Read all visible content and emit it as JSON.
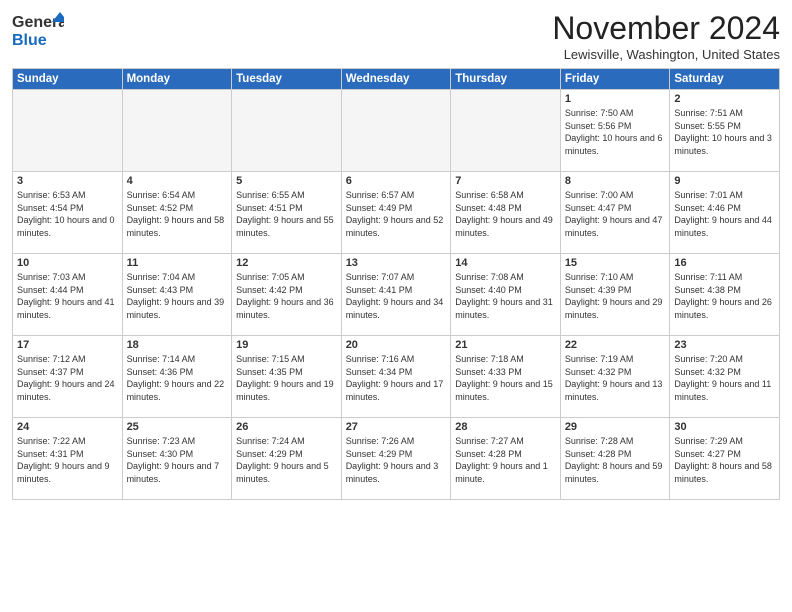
{
  "header": {
    "logo_general": "General",
    "logo_blue": "Blue",
    "month_title": "November 2024",
    "location": "Lewisville, Washington, United States"
  },
  "calendar": {
    "days_of_week": [
      "Sunday",
      "Monday",
      "Tuesday",
      "Wednesday",
      "Thursday",
      "Friday",
      "Saturday"
    ],
    "weeks": [
      [
        {
          "day": "",
          "detail": ""
        },
        {
          "day": "",
          "detail": ""
        },
        {
          "day": "",
          "detail": ""
        },
        {
          "day": "",
          "detail": ""
        },
        {
          "day": "",
          "detail": ""
        },
        {
          "day": "1",
          "detail": "Sunrise: 7:50 AM\nSunset: 5:56 PM\nDaylight: 10 hours and 6 minutes."
        },
        {
          "day": "2",
          "detail": "Sunrise: 7:51 AM\nSunset: 5:55 PM\nDaylight: 10 hours and 3 minutes."
        }
      ],
      [
        {
          "day": "3",
          "detail": "Sunrise: 6:53 AM\nSunset: 4:54 PM\nDaylight: 10 hours and 0 minutes."
        },
        {
          "day": "4",
          "detail": "Sunrise: 6:54 AM\nSunset: 4:52 PM\nDaylight: 9 hours and 58 minutes."
        },
        {
          "day": "5",
          "detail": "Sunrise: 6:55 AM\nSunset: 4:51 PM\nDaylight: 9 hours and 55 minutes."
        },
        {
          "day": "6",
          "detail": "Sunrise: 6:57 AM\nSunset: 4:49 PM\nDaylight: 9 hours and 52 minutes."
        },
        {
          "day": "7",
          "detail": "Sunrise: 6:58 AM\nSunset: 4:48 PM\nDaylight: 9 hours and 49 minutes."
        },
        {
          "day": "8",
          "detail": "Sunrise: 7:00 AM\nSunset: 4:47 PM\nDaylight: 9 hours and 47 minutes."
        },
        {
          "day": "9",
          "detail": "Sunrise: 7:01 AM\nSunset: 4:46 PM\nDaylight: 9 hours and 44 minutes."
        }
      ],
      [
        {
          "day": "10",
          "detail": "Sunrise: 7:03 AM\nSunset: 4:44 PM\nDaylight: 9 hours and 41 minutes."
        },
        {
          "day": "11",
          "detail": "Sunrise: 7:04 AM\nSunset: 4:43 PM\nDaylight: 9 hours and 39 minutes."
        },
        {
          "day": "12",
          "detail": "Sunrise: 7:05 AM\nSunset: 4:42 PM\nDaylight: 9 hours and 36 minutes."
        },
        {
          "day": "13",
          "detail": "Sunrise: 7:07 AM\nSunset: 4:41 PM\nDaylight: 9 hours and 34 minutes."
        },
        {
          "day": "14",
          "detail": "Sunrise: 7:08 AM\nSunset: 4:40 PM\nDaylight: 9 hours and 31 minutes."
        },
        {
          "day": "15",
          "detail": "Sunrise: 7:10 AM\nSunset: 4:39 PM\nDaylight: 9 hours and 29 minutes."
        },
        {
          "day": "16",
          "detail": "Sunrise: 7:11 AM\nSunset: 4:38 PM\nDaylight: 9 hours and 26 minutes."
        }
      ],
      [
        {
          "day": "17",
          "detail": "Sunrise: 7:12 AM\nSunset: 4:37 PM\nDaylight: 9 hours and 24 minutes."
        },
        {
          "day": "18",
          "detail": "Sunrise: 7:14 AM\nSunset: 4:36 PM\nDaylight: 9 hours and 22 minutes."
        },
        {
          "day": "19",
          "detail": "Sunrise: 7:15 AM\nSunset: 4:35 PM\nDaylight: 9 hours and 19 minutes."
        },
        {
          "day": "20",
          "detail": "Sunrise: 7:16 AM\nSunset: 4:34 PM\nDaylight: 9 hours and 17 minutes."
        },
        {
          "day": "21",
          "detail": "Sunrise: 7:18 AM\nSunset: 4:33 PM\nDaylight: 9 hours and 15 minutes."
        },
        {
          "day": "22",
          "detail": "Sunrise: 7:19 AM\nSunset: 4:32 PM\nDaylight: 9 hours and 13 minutes."
        },
        {
          "day": "23",
          "detail": "Sunrise: 7:20 AM\nSunset: 4:32 PM\nDaylight: 9 hours and 11 minutes."
        }
      ],
      [
        {
          "day": "24",
          "detail": "Sunrise: 7:22 AM\nSunset: 4:31 PM\nDaylight: 9 hours and 9 minutes."
        },
        {
          "day": "25",
          "detail": "Sunrise: 7:23 AM\nSunset: 4:30 PM\nDaylight: 9 hours and 7 minutes."
        },
        {
          "day": "26",
          "detail": "Sunrise: 7:24 AM\nSunset: 4:29 PM\nDaylight: 9 hours and 5 minutes."
        },
        {
          "day": "27",
          "detail": "Sunrise: 7:26 AM\nSunset: 4:29 PM\nDaylight: 9 hours and 3 minutes."
        },
        {
          "day": "28",
          "detail": "Sunrise: 7:27 AM\nSunset: 4:28 PM\nDaylight: 9 hours and 1 minute."
        },
        {
          "day": "29",
          "detail": "Sunrise: 7:28 AM\nSunset: 4:28 PM\nDaylight: 8 hours and 59 minutes."
        },
        {
          "day": "30",
          "detail": "Sunrise: 7:29 AM\nSunset: 4:27 PM\nDaylight: 8 hours and 58 minutes."
        }
      ]
    ]
  }
}
